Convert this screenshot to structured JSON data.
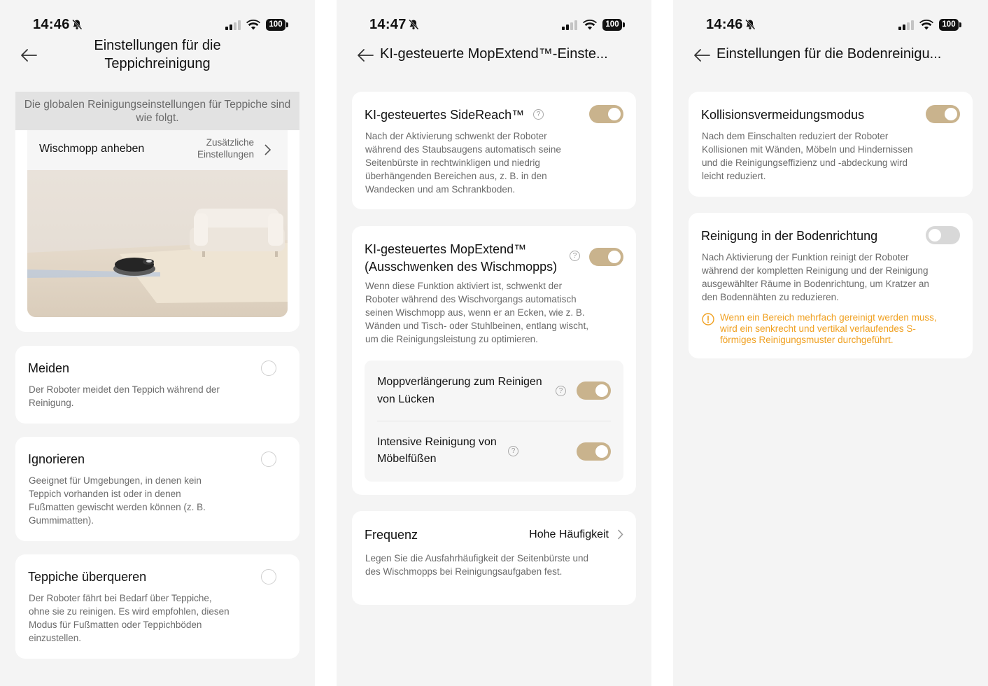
{
  "status": {
    "s1_time": "14:46",
    "s2_time": "14:47",
    "s3_time": "14:46",
    "battery": "100"
  },
  "screen1": {
    "title_line1": "Einstellungen für die",
    "title_line2": "Teppichreinigung",
    "banner": "Die globalen Reinigungseinstellungen für Teppiche sind wie folgt.",
    "mop_lift_label": "Wischmopp anheben",
    "mop_lift_value_line1": "Zusätzliche",
    "mop_lift_value_line2": "Einstellungen",
    "options": [
      {
        "title": "Meiden",
        "desc": "Der Roboter meidet den Teppich während der Reinigung."
      },
      {
        "title": "Ignorieren",
        "desc": "Geeignet für Umgebungen, in denen kein Teppich vorhanden ist oder in denen Fußmatten gewischt werden können (z. B. Gummimatten)."
      },
      {
        "title": "Teppiche überqueren",
        "desc": "Der Roboter fährt bei Bedarf über Teppiche, ohne sie zu reinigen. Es wird empfohlen, diesen Modus für Fußmatten oder Teppichböden einzustellen."
      }
    ]
  },
  "screen2": {
    "title": "KI-gesteuerte MopExtend™-Einste...",
    "sidereach": {
      "title": "KI-gesteuertes SideReach™",
      "desc": "Nach der Aktivierung schwenkt der Roboter während des Staubsaugens automatisch seine Seitenbürste in rechtwinkligen und niedrig überhängenden Bereichen aus, z. B. in den Wandecken und am Schrankboden.",
      "enabled": true
    },
    "mopextend": {
      "title_line1": "KI-gesteuertes MopExtend™",
      "title_line2": "(Ausschwenken des Wischmopps)",
      "desc": "Wenn diese Funktion aktiviert ist, schwenkt der Roboter während des Wischvorgangs automatisch seinen Wischmopp aus, wenn er an Ecken, wie z. B. Wänden und Tisch- oder Stuhlbeinen, entlang wischt, um die Reinigungsleistung zu optimieren.",
      "enabled": true,
      "sub1_line1": "Moppverlängerung zum Reinigen",
      "sub1_line2": "von Lücken",
      "sub1_enabled": true,
      "sub2_line1": "Intensive Reinigung von",
      "sub2_line2": "Möbelfüßen",
      "sub2_enabled": true
    },
    "frequency": {
      "title": "Frequenz",
      "value": "Hohe Häufigkeit",
      "desc": "Legen Sie die Ausfahrhäufigkeit der Seitenbürste und des Wischmopps bei Reinigungsaufgaben fest."
    }
  },
  "screen3": {
    "title": "Einstellungen für die Bodenreinigu...",
    "collision": {
      "title": "Kollisionsvermeidungsmodus",
      "desc": "Nach dem Einschalten reduziert der Roboter Kollisionen mit Wänden, Möbeln und Hindernissen und die Reinigungseffizienz und -abdeckung wird leicht reduziert.",
      "enabled": true
    },
    "floor_direction": {
      "title": "Reinigung in der Bodenrichtung",
      "desc": "Nach Aktivierung der Funktion reinigt der Roboter während der kompletten Reinigung und der Reinigung ausgewählter Räume in Bodenrichtung, um Kratzer an den Bodennähten zu reduzieren.",
      "warning": "Wenn ein Bereich mehrfach gereinigt werden muss, wird ein senkrecht und vertikal verlaufendes S-förmiges Reinigungsmuster durchgeführt.",
      "enabled": false
    }
  },
  "colors": {
    "accent_toggle": "#c9b38d",
    "warning": "#f0a020",
    "background": "#f4f4f4"
  },
  "icons": [
    "back-arrow-icon",
    "bell-muted-icon",
    "signal-icon",
    "wifi-icon",
    "battery-icon",
    "chevron-right-icon",
    "help-icon",
    "warning-icon"
  ]
}
